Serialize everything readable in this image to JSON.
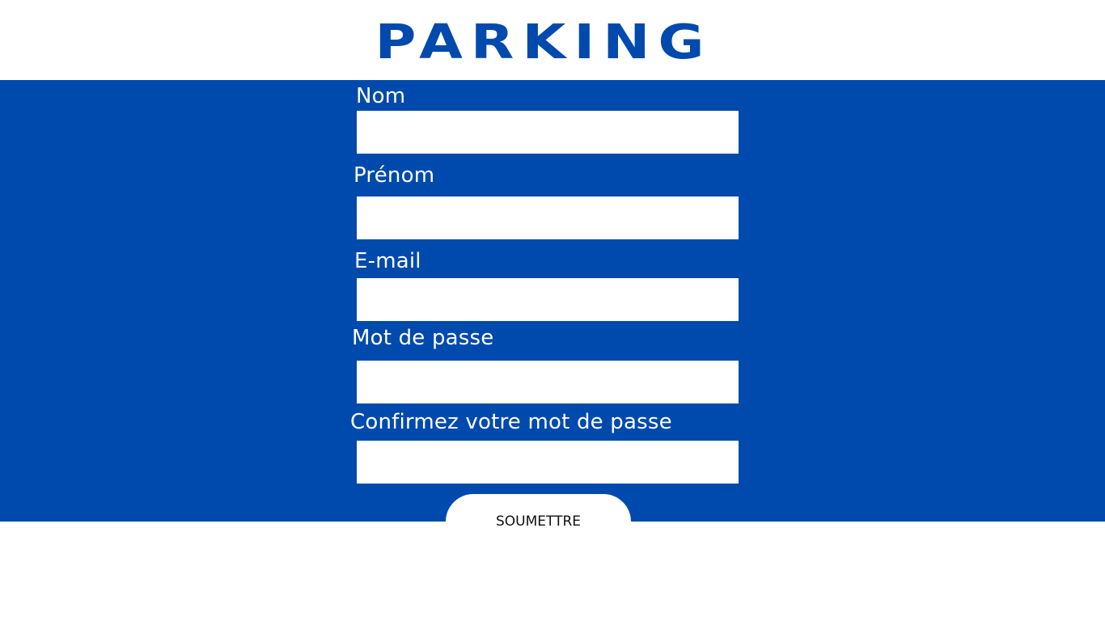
{
  "header": {
    "logo_text": "PARKING",
    "brand_color": "#004aad"
  },
  "form": {
    "background_color": "#004aad",
    "fields": [
      {
        "label": "Nom",
        "value": "",
        "type": "text"
      },
      {
        "label": "Prénom",
        "value": "",
        "type": "text"
      },
      {
        "label": "E-mail",
        "value": "",
        "type": "email"
      },
      {
        "label": "Mot de passe",
        "value": "",
        "type": "password"
      },
      {
        "label": "Confirmez votre mot de passe",
        "value": "",
        "type": "password"
      }
    ],
    "submit_label": "SOUMETTRE"
  }
}
